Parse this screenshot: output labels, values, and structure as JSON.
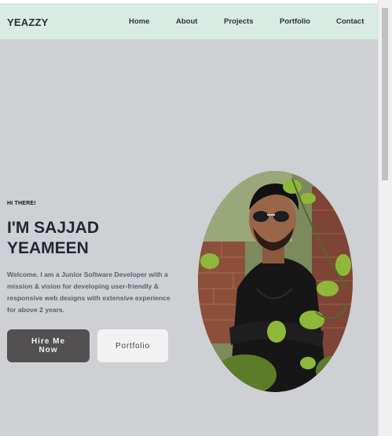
{
  "brand": "YEAZZY",
  "nav": {
    "items": [
      {
        "label": "Home"
      },
      {
        "label": "About"
      },
      {
        "label": "Projects"
      },
      {
        "label": "Portfolio"
      },
      {
        "label": "Contact"
      }
    ]
  },
  "hero": {
    "greeting": "HI THERE!",
    "name_line1": "I'M SAJJAD",
    "name_line2": "YEAMEEN",
    "intro": "Welcome. I am a Junior Software Developer with a mission & vision for developing user-friendly & responsive web designs with extensive experience for above 2 years.",
    "hire_label": "Hire Me Now",
    "portfolio_label": "Portfolio"
  },
  "colors": {
    "navbar_bg": "#d9ece4",
    "page_bg": "#ced0d4",
    "hire_button": "#525051",
    "portfolio_button": "#f2f2f2"
  }
}
